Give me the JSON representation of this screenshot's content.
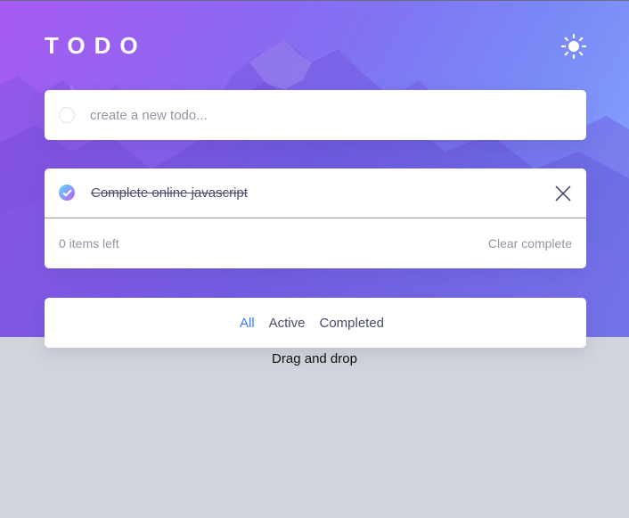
{
  "header": {
    "title": "TODO",
    "theme_icon": "sun-icon"
  },
  "new_todo": {
    "placeholder": "create a new todo...",
    "value": ""
  },
  "todos": [
    {
      "text": "Complete online javascript",
      "completed": true
    }
  ],
  "footer": {
    "items_left": "0 items left",
    "clear_label": "Clear complete"
  },
  "filters": {
    "all": "All",
    "active": "Active",
    "completed": "Completed",
    "selected": "All"
  },
  "hint": "Drag and drop",
  "colors": {
    "accent": "#3a7cfd",
    "check_gradient_start": "#55ddff",
    "check_gradient_end": "#c058f3",
    "page_background": "#d2d4dc",
    "text": "#494c6b",
    "muted_text": "#9495a5"
  }
}
